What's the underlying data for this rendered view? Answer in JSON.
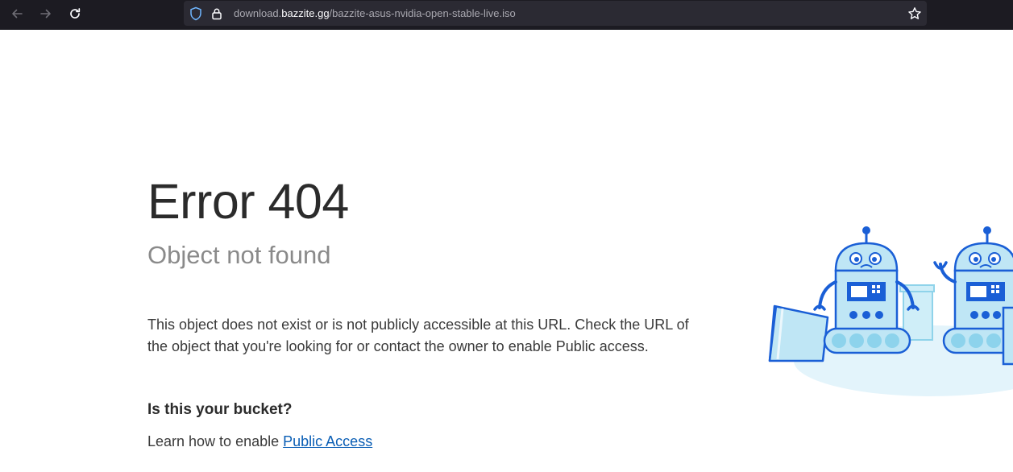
{
  "browser": {
    "back_icon": "arrow-left-icon",
    "forward_icon": "arrow-right-icon",
    "reload_icon": "reload-icon",
    "url_prefix": "download.",
    "url_host": "bazzite.gg",
    "url_path": "/bazzite-asus-nvidia-open-stable-live.iso",
    "shield_icon": "tracking-protection-shield-icon",
    "lock_icon": "lock-icon",
    "bookmark_icon": "star-icon"
  },
  "error": {
    "title": "Error 404",
    "subtitle": "Object not found",
    "description": "This object does not exist or is not publicly accessible at this URL. Check the URL of the object that you're looking for or contact the owner to enable Public access.",
    "bucket_heading": "Is this your bucket?",
    "learn_prefix": "Learn how to enable ",
    "learn_link": "Public Access"
  },
  "colors": {
    "toolbar": "#1c1b22",
    "urlbar": "#2b2a33",
    "link": "#0a5eb5",
    "robot_body": "#bfe6f5",
    "robot_outline": "#1a5fd6"
  }
}
